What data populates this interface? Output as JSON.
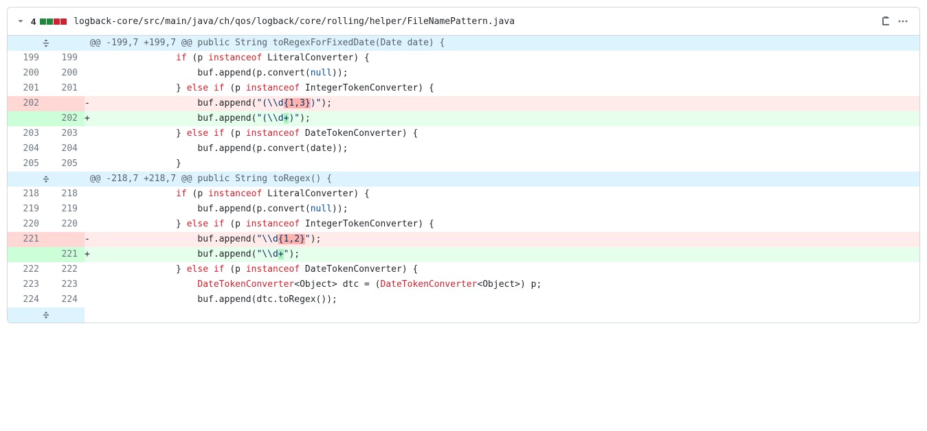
{
  "header": {
    "change_count": "4",
    "file_path": "logback-core/src/main/java/ch/qos/logback/core/rolling/helper/FileNamePattern.java"
  },
  "hunks": [
    {
      "header": "@@ -199,7 +199,7 @@ public String toRegexForFixedDate(Date date) {",
      "lines": [
        {
          "old": "199",
          "new": "199",
          "type": "ctx",
          "tokens": [
            {
              "t": "                ",
              "c": ""
            },
            {
              "t": "if",
              "c": "tok-kw"
            },
            {
              "t": " (p ",
              "c": ""
            },
            {
              "t": "instanceof",
              "c": "tok-kw"
            },
            {
              "t": " LiteralConverter) {",
              "c": ""
            }
          ]
        },
        {
          "old": "200",
          "new": "200",
          "type": "ctx",
          "tokens": [
            {
              "t": "                    buf.append(p.convert(",
              "c": ""
            },
            {
              "t": "null",
              "c": "tok-null"
            },
            {
              "t": "));",
              "c": ""
            }
          ]
        },
        {
          "old": "201",
          "new": "201",
          "type": "ctx",
          "tokens": [
            {
              "t": "                } ",
              "c": ""
            },
            {
              "t": "else",
              "c": "tok-kw"
            },
            {
              "t": " ",
              "c": ""
            },
            {
              "t": "if",
              "c": "tok-kw"
            },
            {
              "t": " (p ",
              "c": ""
            },
            {
              "t": "instanceof",
              "c": "tok-kw"
            },
            {
              "t": " IntegerTokenConverter) {",
              "c": ""
            }
          ]
        },
        {
          "old": "202",
          "new": "",
          "type": "del",
          "tokens": [
            {
              "t": "                    buf.append(",
              "c": ""
            },
            {
              "t": "\"(",
              "c": "tok-str"
            },
            {
              "t": "\\\\",
              "c": "tok-str"
            },
            {
              "t": "d",
              "c": "tok-str"
            },
            {
              "t": "{1,3}",
              "c": "tok-str hl-del"
            },
            {
              "t": ")\"",
              "c": "tok-str"
            },
            {
              "t": ");",
              "c": ""
            }
          ]
        },
        {
          "old": "",
          "new": "202",
          "type": "add",
          "tokens": [
            {
              "t": "                    buf.append(",
              "c": ""
            },
            {
              "t": "\"(",
              "c": "tok-str"
            },
            {
              "t": "\\\\",
              "c": "tok-str"
            },
            {
              "t": "d",
              "c": "tok-str"
            },
            {
              "t": "+",
              "c": "tok-str hl-add"
            },
            {
              "t": ")\"",
              "c": "tok-str"
            },
            {
              "t": ");",
              "c": ""
            }
          ]
        },
        {
          "old": "203",
          "new": "203",
          "type": "ctx",
          "tokens": [
            {
              "t": "                } ",
              "c": ""
            },
            {
              "t": "else",
              "c": "tok-kw"
            },
            {
              "t": " ",
              "c": ""
            },
            {
              "t": "if",
              "c": "tok-kw"
            },
            {
              "t": " (p ",
              "c": ""
            },
            {
              "t": "instanceof",
              "c": "tok-kw"
            },
            {
              "t": " DateTokenConverter) {",
              "c": ""
            }
          ]
        },
        {
          "old": "204",
          "new": "204",
          "type": "ctx",
          "tokens": [
            {
              "t": "                    buf.append(p.convert(date));",
              "c": ""
            }
          ]
        },
        {
          "old": "205",
          "new": "205",
          "type": "ctx",
          "tokens": [
            {
              "t": "                }",
              "c": ""
            }
          ]
        }
      ]
    },
    {
      "header": "@@ -218,7 +218,7 @@ public String toRegex() {",
      "lines": [
        {
          "old": "218",
          "new": "218",
          "type": "ctx",
          "tokens": [
            {
              "t": "                ",
              "c": ""
            },
            {
              "t": "if",
              "c": "tok-kw"
            },
            {
              "t": " (p ",
              "c": ""
            },
            {
              "t": "instanceof",
              "c": "tok-kw"
            },
            {
              "t": " LiteralConverter) {",
              "c": ""
            }
          ]
        },
        {
          "old": "219",
          "new": "219",
          "type": "ctx",
          "tokens": [
            {
              "t": "                    buf.append(p.convert(",
              "c": ""
            },
            {
              "t": "null",
              "c": "tok-null"
            },
            {
              "t": "));",
              "c": ""
            }
          ]
        },
        {
          "old": "220",
          "new": "220",
          "type": "ctx",
          "tokens": [
            {
              "t": "                } ",
              "c": ""
            },
            {
              "t": "else",
              "c": "tok-kw"
            },
            {
              "t": " ",
              "c": ""
            },
            {
              "t": "if",
              "c": "tok-kw"
            },
            {
              "t": " (p ",
              "c": ""
            },
            {
              "t": "instanceof",
              "c": "tok-kw"
            },
            {
              "t": " IntegerTokenConverter) {",
              "c": ""
            }
          ]
        },
        {
          "old": "221",
          "new": "",
          "type": "del",
          "tokens": [
            {
              "t": "                    buf.append(",
              "c": ""
            },
            {
              "t": "\"",
              "c": "tok-str"
            },
            {
              "t": "\\\\",
              "c": "tok-str"
            },
            {
              "t": "d",
              "c": "tok-str"
            },
            {
              "t": "{1,2}",
              "c": "tok-str hl-del"
            },
            {
              "t": "\"",
              "c": "tok-str"
            },
            {
              "t": ");",
              "c": ""
            }
          ]
        },
        {
          "old": "",
          "new": "221",
          "type": "add",
          "tokens": [
            {
              "t": "                    buf.append(",
              "c": ""
            },
            {
              "t": "\"",
              "c": "tok-str"
            },
            {
              "t": "\\\\",
              "c": "tok-str"
            },
            {
              "t": "d",
              "c": "tok-str"
            },
            {
              "t": "+",
              "c": "tok-str hl-add"
            },
            {
              "t": "\"",
              "c": "tok-str"
            },
            {
              "t": ");",
              "c": ""
            }
          ]
        },
        {
          "old": "222",
          "new": "222",
          "type": "ctx",
          "tokens": [
            {
              "t": "                } ",
              "c": ""
            },
            {
              "t": "else",
              "c": "tok-kw"
            },
            {
              "t": " ",
              "c": ""
            },
            {
              "t": "if",
              "c": "tok-kw"
            },
            {
              "t": " (p ",
              "c": ""
            },
            {
              "t": "instanceof",
              "c": "tok-kw"
            },
            {
              "t": " DateTokenConverter) {",
              "c": ""
            }
          ]
        },
        {
          "old": "223",
          "new": "223",
          "type": "ctx",
          "tokens": [
            {
              "t": "                    ",
              "c": ""
            },
            {
              "t": "DateTokenConverter",
              "c": "tok-reddish"
            },
            {
              "t": "<Object> dtc = (",
              "c": ""
            },
            {
              "t": "DateTokenConverter",
              "c": "tok-reddish"
            },
            {
              "t": "<Object>) p;",
              "c": ""
            }
          ]
        },
        {
          "old": "224",
          "new": "224",
          "type": "ctx",
          "tokens": [
            {
              "t": "                    buf.append(dtc.toRegex());",
              "c": ""
            }
          ]
        }
      ]
    }
  ]
}
